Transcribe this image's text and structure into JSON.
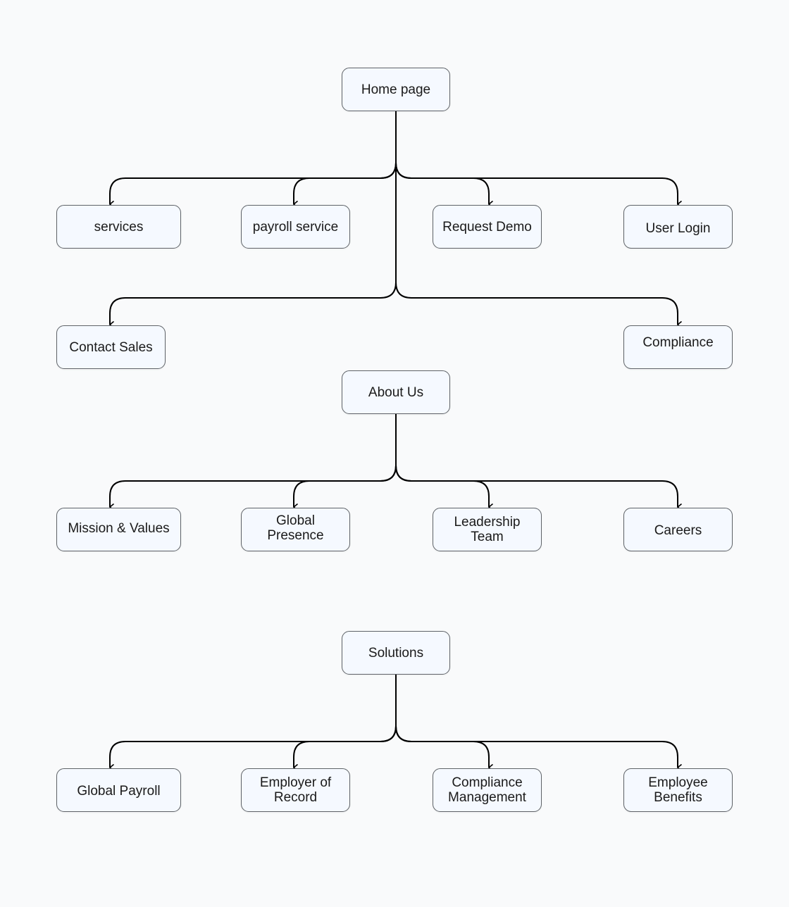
{
  "diagram": {
    "type": "sitemap",
    "line_color": "#000000",
    "node_fill": "#f5f9ff",
    "node_border": "#5f6368",
    "sections": [
      {
        "root": "Home page",
        "children": [
          "services",
          "payroll service",
          "Request Demo",
          "User Login",
          "Contact Sales",
          "Compliance"
        ]
      },
      {
        "root": "About Us",
        "children": [
          "Mission & Values",
          "Global\nPresence",
          "Leadership\nTeam",
          "Careers"
        ]
      },
      {
        "root": "Solutions",
        "children": [
          "Global Payroll",
          "Employer of\nRecord",
          "Compliance\nManagement",
          "Employee\nBenefits"
        ]
      }
    ]
  }
}
